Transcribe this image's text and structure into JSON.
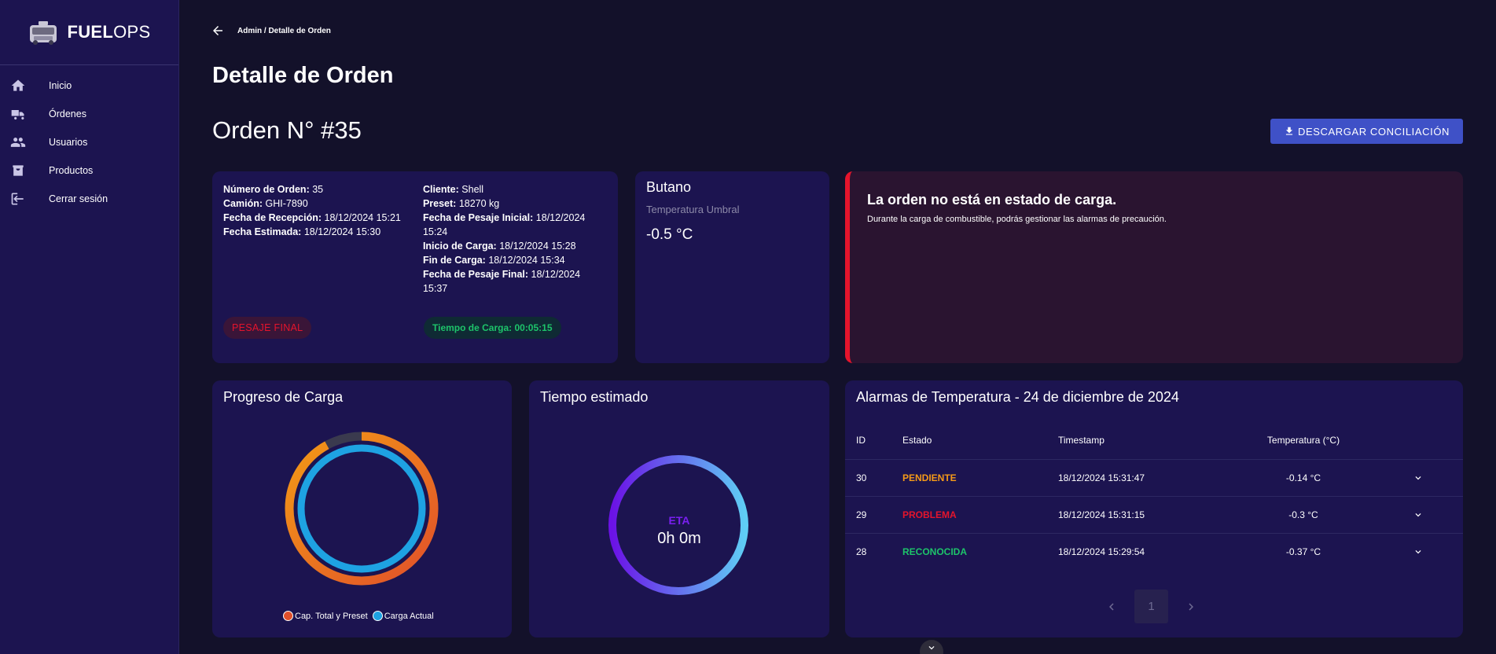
{
  "brand": {
    "name_bold": "FUEL",
    "name_light": "OPS"
  },
  "sidebar": {
    "items": [
      {
        "label": "Inicio",
        "icon": "home-icon"
      },
      {
        "label": "Órdenes",
        "icon": "truck-icon"
      },
      {
        "label": "Usuarios",
        "icon": "users-icon"
      },
      {
        "label": "Productos",
        "icon": "product-icon"
      },
      {
        "label": "Cerrar sesión",
        "icon": "logout-icon"
      }
    ]
  },
  "header": {
    "breadcrumb": "Admin / Detalle de Orden",
    "page_title": "Detalle de Orden",
    "order_title": "Orden N° #35",
    "download_label": "DESCARGAR CONCILIACIÓN"
  },
  "order": {
    "left": [
      {
        "k": "Número de Orden:",
        "v": "35"
      },
      {
        "k": "Camión:",
        "v": "GHI-7890"
      },
      {
        "k": "Fecha de Recepción:",
        "v": "18/12/2024 15:21"
      },
      {
        "k": "Fecha Estimada:",
        "v": "18/12/2024 15:30"
      }
    ],
    "right": [
      {
        "k": "Cliente:",
        "v": "Shell"
      },
      {
        "k": "Preset:",
        "v": "18270 kg"
      },
      {
        "k": "Fecha de Pesaje Inicial:",
        "v": "18/12/2024 15:24"
      },
      {
        "k": "Inicio de Carga:",
        "v": "18/12/2024 15:28"
      },
      {
        "k": "Fin de Carga:",
        "v": "18/12/2024 15:34"
      },
      {
        "k": "Fecha de Pesaje Final:",
        "v": "18/12/2024 15:37"
      }
    ],
    "status": "PESAJE FINAL",
    "load_time": "Tiempo de Carga: 00:05:15"
  },
  "product": {
    "name": "Butano",
    "threshold_label": "Temperatura Umbral",
    "threshold_value": "-0.5 °C"
  },
  "alert": {
    "title": "La orden no está en estado de carga.",
    "message": "Durante la carga de combustible, podrás gestionar las alarmas de precaución."
  },
  "progress": {
    "title": "Progreso de Carga",
    "legend": [
      "Cap. Total y Preset",
      "Carga Actual"
    ],
    "colors": {
      "outer_start": "#e1502a",
      "outer_end": "#f39a16",
      "inner": "#1ea2e2",
      "track": "#3a3a4e"
    },
    "outer_fraction": 0.92,
    "inner_fraction": 1.0
  },
  "eta": {
    "title": "Tiempo estimado",
    "label": "ETA",
    "value": "0h 0m",
    "colors": {
      "start": "#6b12e6",
      "end": "#5fcdf5"
    }
  },
  "alarms": {
    "title": "Alarmas de Temperatura - 24 de diciembre de 2024",
    "headers": [
      "ID",
      "Estado",
      "Timestamp",
      "Temperatura (°C)"
    ],
    "rows": [
      {
        "id": "30",
        "estado": "PENDIENTE",
        "ts": "18/12/2024 15:31:47",
        "temp": "-0.14 °C"
      },
      {
        "id": "29",
        "estado": "PROBLEMA",
        "ts": "18/12/2024 15:31:15",
        "temp": "-0.3 °C"
      },
      {
        "id": "28",
        "estado": "RECONOCIDA",
        "ts": "18/12/2024 15:29:54",
        "temp": "-0.37 °C"
      }
    ],
    "page": "1"
  }
}
